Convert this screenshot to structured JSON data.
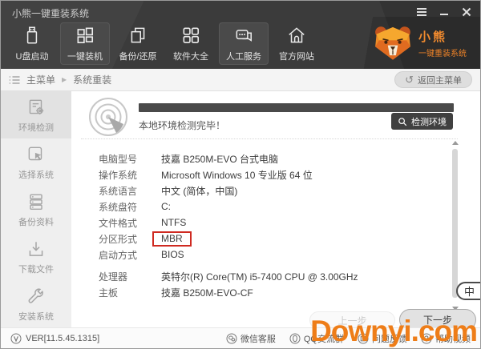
{
  "window": {
    "title": "小熊一键重装系统"
  },
  "toolbar": {
    "items": [
      {
        "label": "U盘启动",
        "icon": "usb-drive-icon",
        "active": false
      },
      {
        "label": "一键装机",
        "icon": "modules-icon",
        "active": true
      },
      {
        "label": "备份/还原",
        "icon": "backup-restore-icon",
        "active": false
      },
      {
        "label": "软件大全",
        "icon": "apps-grid-icon",
        "active": false
      },
      {
        "label": "人工服务",
        "icon": "chat-service-icon",
        "active": true
      },
      {
        "label": "官方网站",
        "icon": "home-icon",
        "active": false
      }
    ],
    "brand": {
      "name": "小熊",
      "subtitle": "一键重装系统",
      "icon": "bear-logo-icon"
    }
  },
  "breadcrumb": {
    "root": "主菜单",
    "separator": "▶",
    "current": "系统重装",
    "back_button": "返回主菜单"
  },
  "sidebar": {
    "items": [
      {
        "label": "环境检测",
        "icon": "document-gear-icon",
        "selected": true
      },
      {
        "label": "选择系统",
        "icon": "cursor-select-icon",
        "selected": false
      },
      {
        "label": "备份资料",
        "icon": "server-stack-icon",
        "selected": false
      },
      {
        "label": "下载文件",
        "icon": "download-icon",
        "selected": false
      },
      {
        "label": "安装系统",
        "icon": "wrench-icon",
        "selected": false
      }
    ]
  },
  "main": {
    "status_text": "本地环境检测完毕！",
    "progress_percent": 100,
    "detect_button": "检测环境",
    "specs": [
      {
        "label": "电脑型号",
        "value": "技嘉 B250M-EVO 台式电脑",
        "highlight": false
      },
      {
        "label": "操作系统",
        "value": "Microsoft Windows 10 专业版 64 位",
        "highlight": false
      },
      {
        "label": "系统语言",
        "value": "中文 (简体，中国)",
        "highlight": false
      },
      {
        "label": "系统盘符",
        "value": "C:",
        "highlight": false
      },
      {
        "label": "文件格式",
        "value": "NTFS",
        "highlight": false
      },
      {
        "label": "分区形式",
        "value": "MBR",
        "highlight": true
      },
      {
        "label": "启动方式",
        "value": "BIOS",
        "highlight": false
      },
      {
        "label": "处理器",
        "value": "英特尔(R) Core(TM) i5-7400 CPU @ 3.00GHz",
        "highlight": false
      },
      {
        "label": "主板",
        "value": "技嘉 B250M-EVO-CF",
        "highlight": false
      }
    ],
    "prev_button": "上一步",
    "next_button": "下一步",
    "floating_badge": "中"
  },
  "statusbar": {
    "version": "VER[11.5.45.1315]",
    "links": [
      {
        "label": "微信客服",
        "icon": "wechat-icon"
      },
      {
        "label": "QQ交流群",
        "icon": "qq-icon"
      },
      {
        "label": "问题反馈",
        "icon": "feedback-icon"
      },
      {
        "label": "帮助视频",
        "icon": "help-icon"
      }
    ]
  },
  "watermark": "Downyi.com",
  "colors": {
    "header_bg": "#3b3b3b",
    "accent_orange": "#f08a2e",
    "highlight_red": "#cf2a21",
    "watermark_orange": "#ee7d18"
  }
}
